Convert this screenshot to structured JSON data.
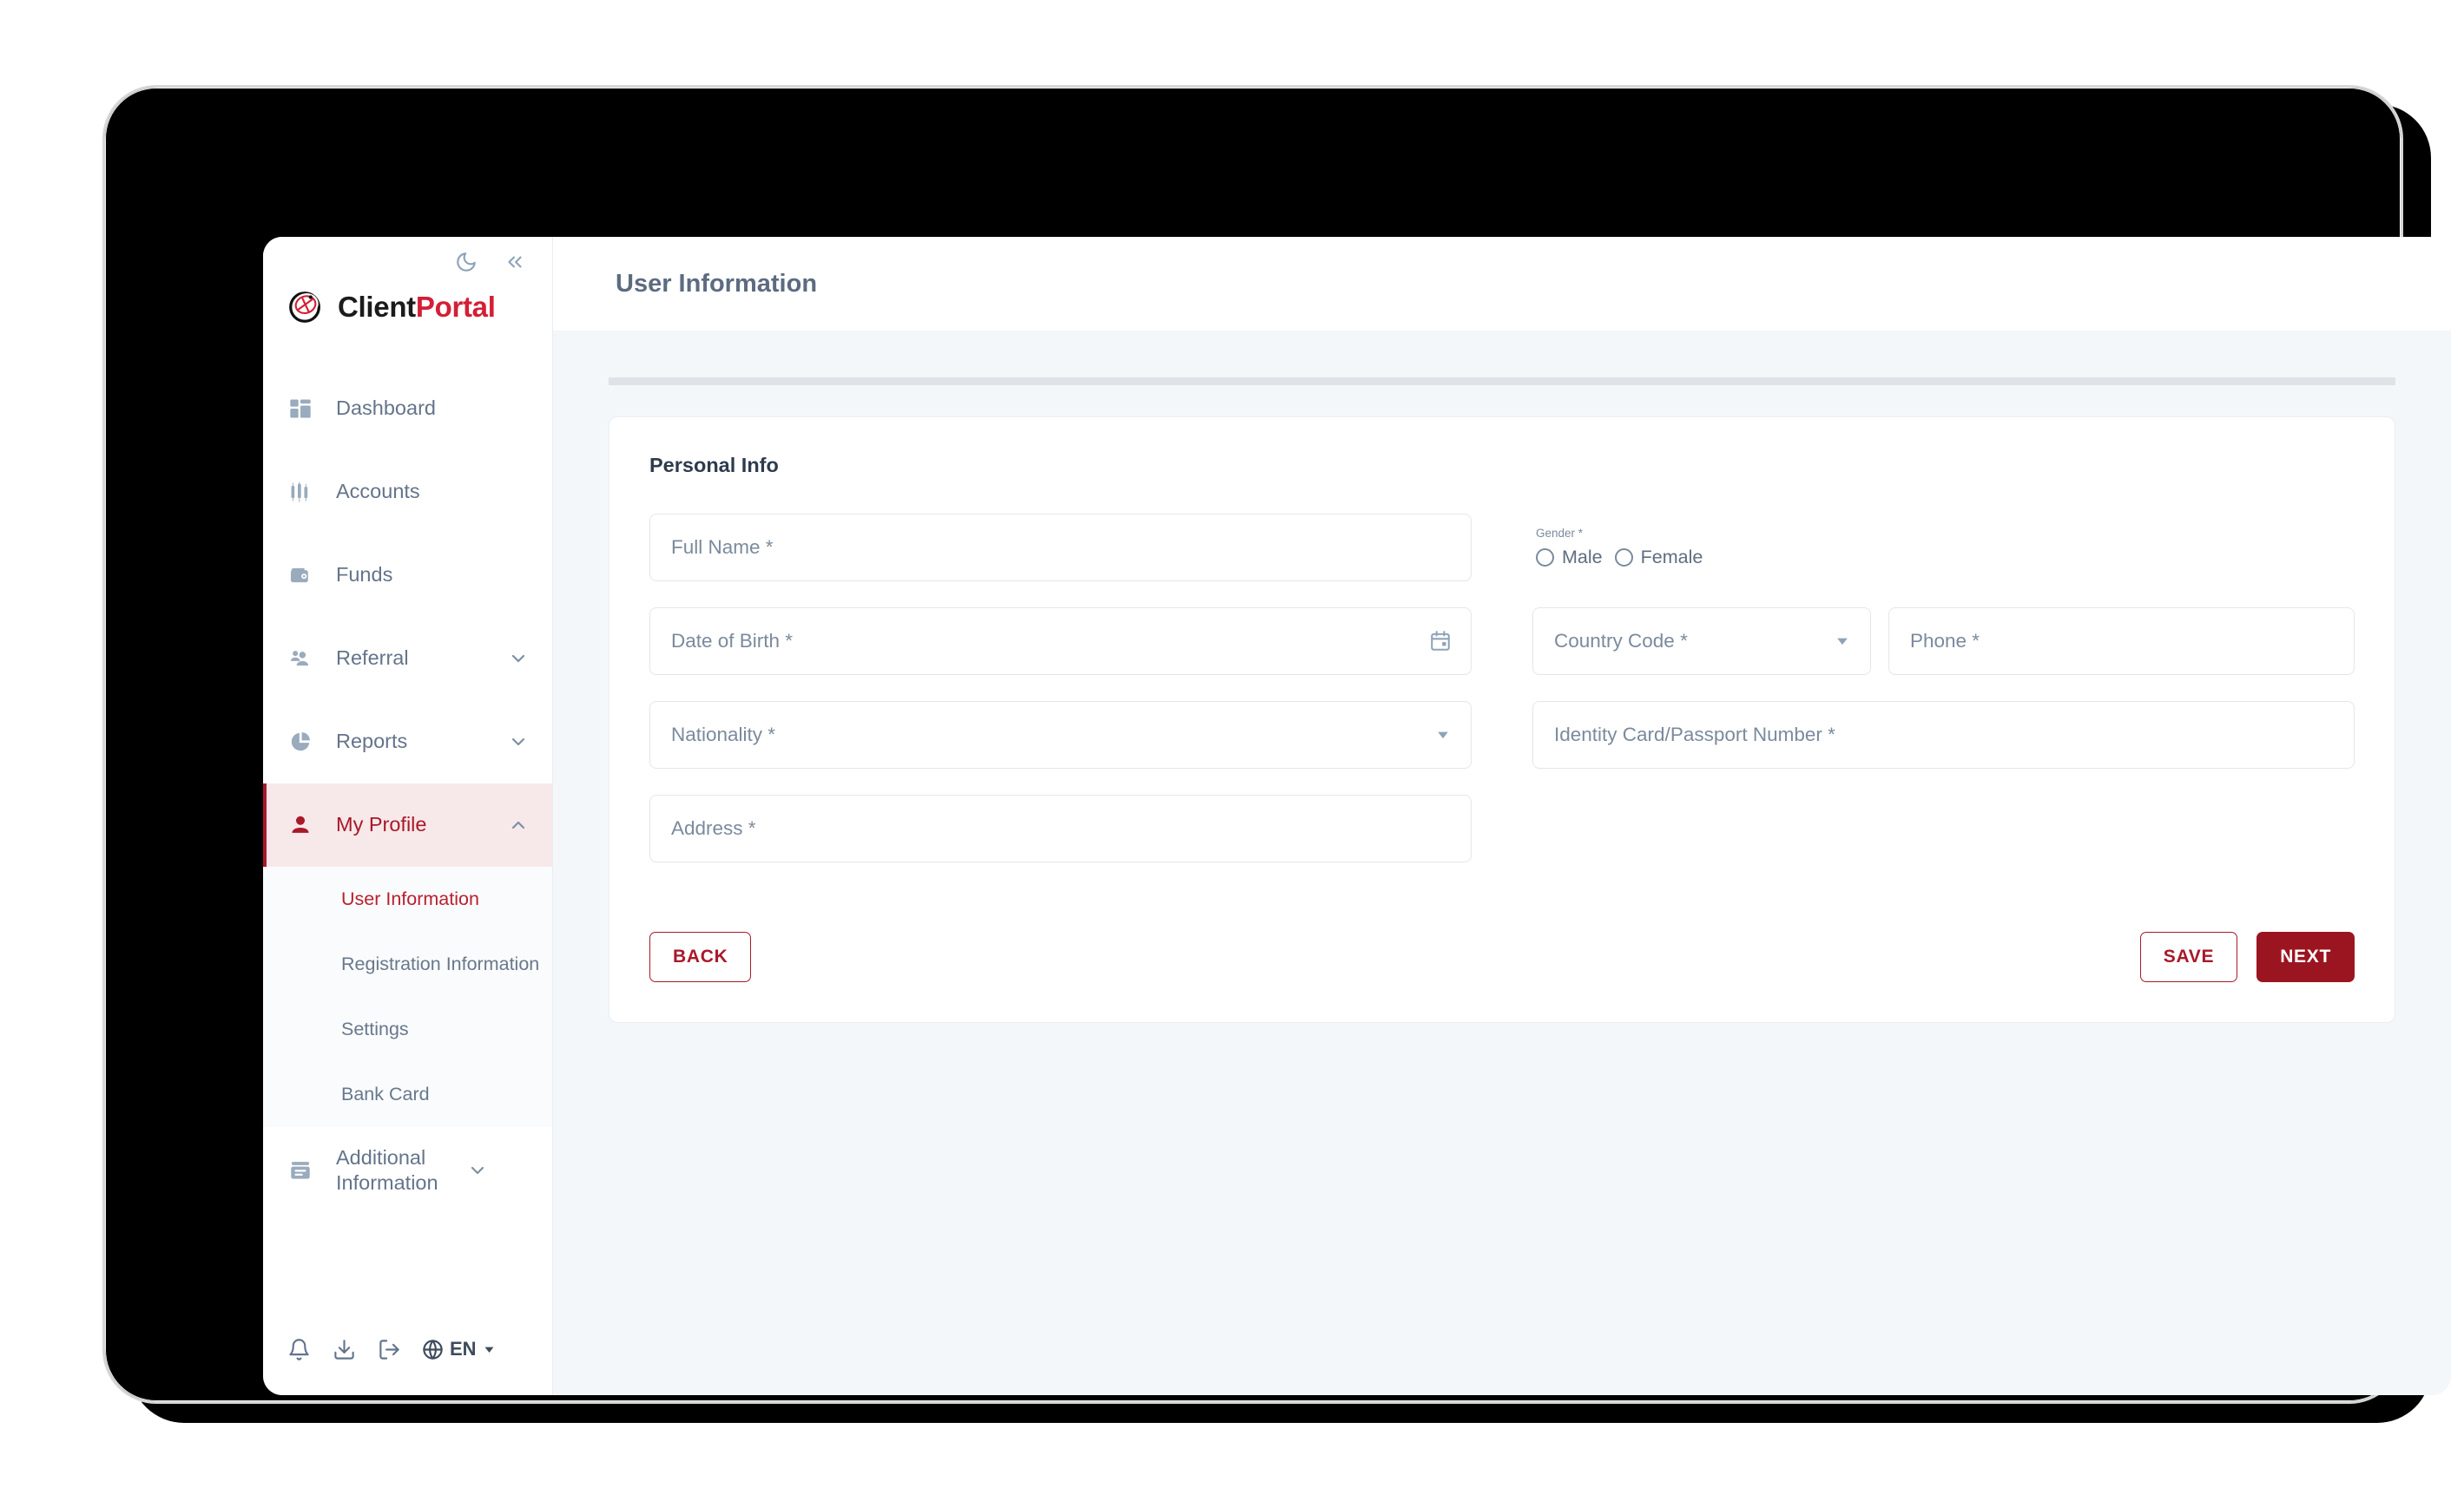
{
  "brand": {
    "name_part1": "Client",
    "name_part2": "Portal"
  },
  "sidebar": {
    "top_icons": [
      {
        "name": "dark-mode-icon",
        "label": "moon"
      },
      {
        "name": "collapse-sidebar-icon",
        "label": "chevrons-left"
      }
    ],
    "items": [
      {
        "label": "Dashboard",
        "icon": "dashboard-icon",
        "chevron": "",
        "active": false
      },
      {
        "label": "Accounts",
        "icon": "accounts-icon",
        "chevron": "",
        "active": false
      },
      {
        "label": "Funds",
        "icon": "funds-wallet-icon",
        "chevron": "",
        "active": false
      },
      {
        "label": "Referral",
        "icon": "referral-people-icon",
        "chevron": "down",
        "active": false
      },
      {
        "label": "Reports",
        "icon": "reports-piechart-icon",
        "chevron": "down",
        "active": false
      },
      {
        "label": "My Profile",
        "icon": "profile-person-icon",
        "chevron": "up",
        "active": true
      }
    ],
    "submenu": [
      {
        "label": "User Information",
        "active": true
      },
      {
        "label": "Registration Information",
        "active": false
      },
      {
        "label": "Settings",
        "active": false
      },
      {
        "label": "Bank Card",
        "active": false
      }
    ],
    "additional": {
      "label": "Additional Information",
      "icon": "additional-info-icon",
      "chevron": "down"
    },
    "footer": {
      "icons": [
        {
          "name": "notifications-bell-icon"
        },
        {
          "name": "download-icon"
        },
        {
          "name": "logout-icon"
        }
      ],
      "language": "EN"
    }
  },
  "header": {
    "title": "User Information"
  },
  "form": {
    "card_title": "Personal Info",
    "full_name": {
      "label": "Full Name *",
      "value": ""
    },
    "date_of_birth": {
      "label": "Date of Birth *",
      "value": "",
      "icon": "calendar-icon"
    },
    "nationality": {
      "label": "Nationality *",
      "value": "",
      "icon": "chevron-down-icon"
    },
    "address": {
      "label": "Address *",
      "value": ""
    },
    "gender": {
      "label": "Gender *",
      "options": [
        {
          "label": "Male",
          "selected": false
        },
        {
          "label": "Female",
          "selected": false
        }
      ]
    },
    "country_code": {
      "label": "Country Code *",
      "value": "",
      "icon": "chevron-down-icon"
    },
    "phone": {
      "label": "Phone *",
      "value": ""
    },
    "identity_number": {
      "label": "Identity Card/Passport Number *",
      "value": ""
    }
  },
  "buttons": {
    "back": "BACK",
    "save": "SAVE",
    "next": "NEXT"
  },
  "colors": {
    "brand_red": "#d31f35",
    "accent_dark_red": "#a8192a",
    "solid_button": "#9b1520",
    "active_nav_bg": "#f7e8e9",
    "page_bg": "#f4f7f9",
    "muted_text": "#7b8a9d"
  }
}
